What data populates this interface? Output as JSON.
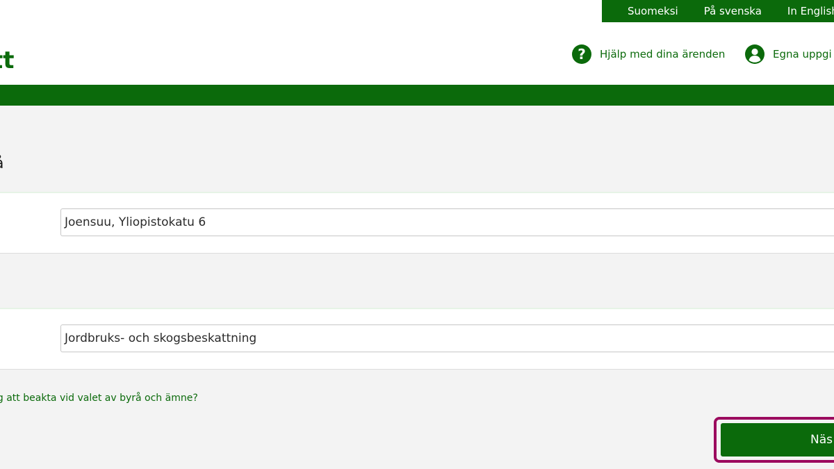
{
  "language_bar": {
    "finnish": "Suomeksi",
    "swedish": "På svenska",
    "english": "In English"
  },
  "header": {
    "logo_text": "tt",
    "help_link": "Hjälp med dina ärenden",
    "profile_link": "Egna uppgi"
  },
  "section": {
    "heading_fragment": "å"
  },
  "office_field": {
    "value": "Joensuu, Yliopistokatu 6"
  },
  "topic_field": {
    "value": "Jordbruks- och skogsbeskattning"
  },
  "note_link": "ig att beakta vid valet av byrå och ämne?",
  "next_button_label": "Näs",
  "colors": {
    "brand_green": "#0b6a0b",
    "focus_ring": "#9b0a5e",
    "page_background": "#f3f3f3"
  },
  "icons": {
    "help": "question-circle-icon",
    "profile": "user-circle-icon"
  }
}
